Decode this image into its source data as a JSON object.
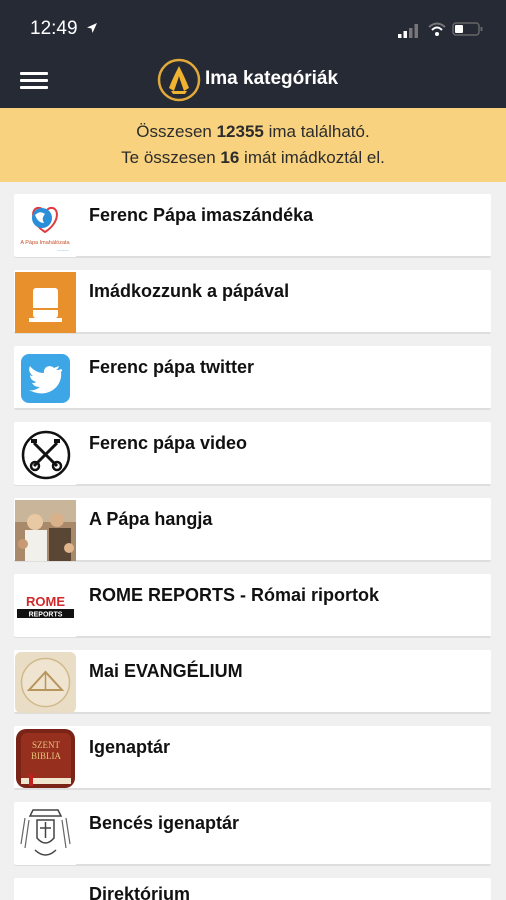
{
  "status": {
    "time": "12:49"
  },
  "header": {
    "title": "Ima kategóriák",
    "menu_icon": "hamburger-icon",
    "logo_icon": "praying-hands-icon"
  },
  "banner": {
    "l1_pre": "Összesen ",
    "l1_num": "12355",
    "l1_post": " ima található.",
    "l2_pre": "Te összesen ",
    "l2_num": "16",
    "l2_post": " imát imádkoztál el."
  },
  "categories": [
    {
      "label": "Ferenc Pápa imaszándéka",
      "icon": "globe-heart-icon",
      "icon_caption": "A Pápa Imahálózata"
    },
    {
      "label": "Imádkozzunk a pápával",
      "icon": "candle-icon"
    },
    {
      "label": "Ferenc pápa twitter",
      "icon": "twitter-bird-icon"
    },
    {
      "label": "Ferenc pápa video",
      "icon": "crossed-keys-icon"
    },
    {
      "label": "A Pápa hangja",
      "icon": "pope-photo-icon"
    },
    {
      "label": "ROME REPORTS - Római riportok",
      "icon": "rome-reports-logo",
      "icon_caption": "ROME REPORTS"
    },
    {
      "label": "Mai EVANGÉLIUM",
      "icon": "evangelium-logo-icon"
    },
    {
      "label": "Igenaptár",
      "icon": "bible-book-icon",
      "icon_caption": "SZENT BIBLIA"
    },
    {
      "label": "Bencés igenaptár",
      "icon": "coat-of-arms-icon"
    },
    {
      "label": "Direktórium",
      "icon": "direktorium-icon"
    }
  ],
  "colors": {
    "header_bg": "#262a35",
    "banner_bg": "#f8d27e",
    "accent_gold": "#f0b32f"
  }
}
